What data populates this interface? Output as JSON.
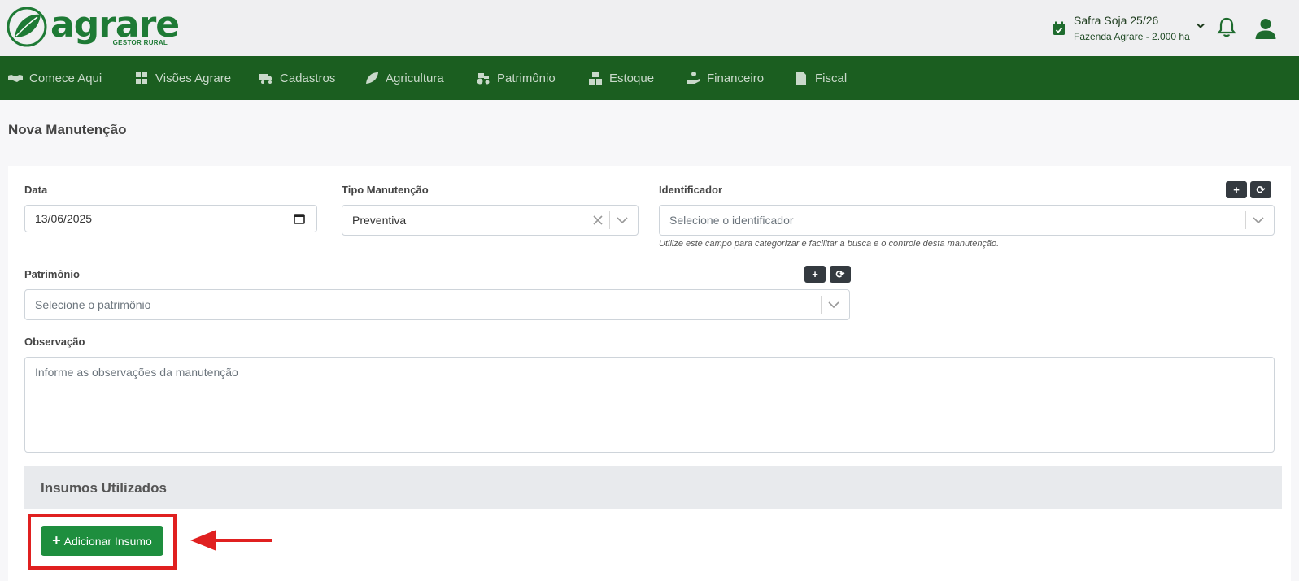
{
  "brand": {
    "name": "agrare",
    "tagline": "GESTOR RURAL",
    "color": "#1e7a35"
  },
  "header": {
    "safra_title": "Safra Soja 25/26",
    "safra_subtitle": "Fazenda Agrare - 2.000 ha"
  },
  "nav": {
    "items": [
      {
        "label": "Comece Aqui",
        "icon": "handshake-icon"
      },
      {
        "label": "Visões Agrare",
        "icon": "grid-icon"
      },
      {
        "label": "Cadastros",
        "icon": "truck-icon"
      },
      {
        "label": "Agricultura",
        "icon": "leaf-icon"
      },
      {
        "label": "Patrimônio",
        "icon": "tractor-icon"
      },
      {
        "label": "Estoque",
        "icon": "boxes-icon"
      },
      {
        "label": "Financeiro",
        "icon": "hand-coin-icon"
      },
      {
        "label": "Fiscal",
        "icon": "file-invoice-icon"
      }
    ],
    "background": "#1b5e20"
  },
  "page": {
    "title": "Nova Manutenção"
  },
  "form": {
    "data_label": "Data",
    "data_value": "13/06/2025",
    "tipo_label": "Tipo Manutenção",
    "tipo_value": "Preventiva",
    "identificador_label": "Identificador",
    "identificador_placeholder": "Selecione o identificador",
    "identificador_hint": "Utilize este campo para categorizar e facilitar a busca e o controle desta manutenção.",
    "patrimonio_label": "Patrimônio",
    "patrimonio_placeholder": "Selecione o patrimônio",
    "observacao_label": "Observação",
    "observacao_placeholder": "Informe as observações da manutenção",
    "add_symbol": "+",
    "refresh_symbol": "⟳"
  },
  "insumos": {
    "title": "Insumos Utilizados",
    "add_button": "Adicionar Insumo"
  },
  "annotation": {
    "highlight_color": "#e02020"
  }
}
